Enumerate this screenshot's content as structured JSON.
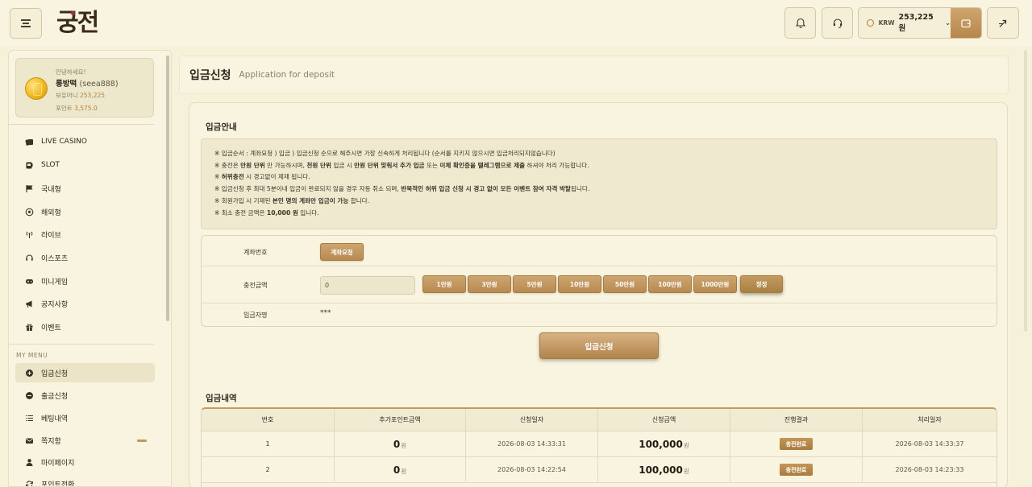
{
  "header": {
    "logo_text": "궁전",
    "wallet": {
      "currency": "KRW",
      "amount": "253,225 원"
    }
  },
  "sidebar": {
    "user": {
      "greeting": "안녕하세요!",
      "name": "룽방떡",
      "id": "(seea888)",
      "money_label": "보유머니",
      "money": "253,225",
      "point_label": "포인트",
      "point": "3,575.0"
    },
    "nav": [
      {
        "label": "LIVE CASINO",
        "icon": "cards-icon"
      },
      {
        "label": "SLOT",
        "icon": "slot-icon"
      },
      {
        "label": "국내형",
        "icon": "flag-icon"
      },
      {
        "label": "해외형",
        "icon": "soccer-ball-icon"
      },
      {
        "label": "라이브",
        "icon": "antenna-icon"
      },
      {
        "label": "이스포츠",
        "icon": "headset-icon"
      },
      {
        "label": "미니게임",
        "icon": "gamepad-icon"
      },
      {
        "label": "공지사항",
        "icon": "megaphone-icon"
      },
      {
        "label": "이벤트",
        "icon": "gift-icon"
      }
    ],
    "my_menu_label": "MY MENU",
    "my_menu": [
      {
        "label": "입금신청",
        "icon": "plus-circle-icon",
        "active": true
      },
      {
        "label": "출금신청",
        "icon": "minus-circle-icon"
      },
      {
        "label": "베팅내역",
        "icon": "list-icon"
      },
      {
        "label": "쪽지함",
        "icon": "mail-icon"
      },
      {
        "label": "마이페이지",
        "icon": "user-icon"
      },
      {
        "label": "포인트전환",
        "icon": "refresh-icon"
      }
    ]
  },
  "page": {
    "title": "입금신청",
    "subtitle": "Application for deposit"
  },
  "notice": {
    "title": "입금안내",
    "lines": [
      [
        "※ 입금순서 : 계좌요청 ) 입금 ) 입금신청 순으로 해주시면 가장 신속하게 처리됩니다 (순서를 지키지 않으시면 입금처리되지않습니다)"
      ],
      [
        "※ 충전은 ",
        "만원 단위",
        " 만 가능하시며, ",
        "천원 단위",
        " 입금 시 ",
        "만원 단위 맞춰서 추가 입금",
        " 또는 ",
        "이체 확인증을 텔레그램으로 제출",
        " 하셔야 처리 가능합니다."
      ],
      [
        "※ ",
        "허위충전",
        " 시 경고없이 제재 됩니다."
      ],
      [
        "※ 입금신청 후 최대 5분이내 입금이 완료되지 않을 경우 자동 취소 되며, ",
        "반복적인 허위 입금 신청 시 경고 없이 모든 이벤트 참여 자격 박탈",
        "됩니다."
      ],
      [
        "※ 회원가입 시 기재된 ",
        "본인 명의 계좌만 입금이 가능",
        " 합니다."
      ],
      [
        "※ 최소 충전 금액은 ",
        "10,000 원",
        " 입니다."
      ]
    ]
  },
  "form": {
    "account_label": "계좌번호",
    "account_button": "계좌요청",
    "amount_label": "충전금액",
    "amount_value": "0",
    "amount_buttons": [
      "1만원",
      "3만원",
      "5만원",
      "10만원",
      "50만원",
      "100만원",
      "1000만원"
    ],
    "reset_button": "정정",
    "depositor_label": "입금자명",
    "depositor_value": "***",
    "submit_button": "입금신청"
  },
  "history": {
    "title": "입금내역",
    "columns": [
      "번호",
      "추가포인트금액",
      "신청일자",
      "신청금액",
      "진행결과",
      "처리일자"
    ],
    "unit": "원",
    "rows": [
      {
        "no": "1",
        "bonus": "0",
        "applied": "2026-08-03 14:33:31",
        "amount": "100,000",
        "status": "충전완료",
        "processed": "2026-08-03 14:33:37"
      },
      {
        "no": "2",
        "bonus": "0",
        "applied": "2026-08-03 14:22:54",
        "amount": "100,000",
        "status": "충전완료",
        "processed": "2026-08-03 14:23:33"
      }
    ]
  }
}
